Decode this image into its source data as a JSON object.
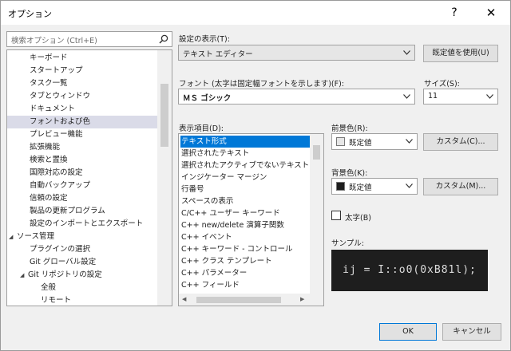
{
  "window": {
    "title": "オプション",
    "help_label": "?",
    "close_label": "✕"
  },
  "search": {
    "placeholder": "検索オプション (Ctrl+E)"
  },
  "tree": {
    "items": [
      {
        "label": "キーボード",
        "indent": 1
      },
      {
        "label": "スタートアップ",
        "indent": 1
      },
      {
        "label": "タスク一覧",
        "indent": 1
      },
      {
        "label": "タブとウィンドウ",
        "indent": 1
      },
      {
        "label": "ドキュメント",
        "indent": 1
      },
      {
        "label": "フォントおよび色",
        "indent": 1,
        "selected": true
      },
      {
        "label": "プレビュー機能",
        "indent": 1
      },
      {
        "label": "拡張機能",
        "indent": 1
      },
      {
        "label": "検索と置換",
        "indent": 1
      },
      {
        "label": "国際対応の設定",
        "indent": 1
      },
      {
        "label": "自動バックアップ",
        "indent": 1
      },
      {
        "label": "信頼の設定",
        "indent": 1
      },
      {
        "label": "製品の更新プログラム",
        "indent": 1
      },
      {
        "label": "設定のインポートとエクスポート",
        "indent": 1
      },
      {
        "label": "ソース管理",
        "indent": 0,
        "expanded": true
      },
      {
        "label": "プラグインの選択",
        "indent": 1
      },
      {
        "label": "Git グローバル設定",
        "indent": 1
      },
      {
        "label": "Git リポジトリの設定",
        "indent": 1,
        "expanded": true
      },
      {
        "label": "全般",
        "indent": 2
      },
      {
        "label": "リモート",
        "indent": 2
      }
    ]
  },
  "settings_display": {
    "label": "設定の表示(T):",
    "value": "テキスト エディター"
  },
  "use_defaults_label": "既定値を使用(U)",
  "font": {
    "label": "フォント (太字は固定幅フォントを示します)(F):",
    "value": "ＭＳ ゴシック"
  },
  "size": {
    "label": "サイズ(S):",
    "value": "11"
  },
  "display_items": {
    "label": "表示項目(D):",
    "items": [
      {
        "label": "テキスト形式",
        "selected": true
      },
      {
        "label": "選択されたテキスト"
      },
      {
        "label": "選択されたアクティブでないテキスト"
      },
      {
        "label": "インジケーター マージン"
      },
      {
        "label": "行番号"
      },
      {
        "label": "スペースの表示"
      },
      {
        "label": "C/C++ ユーザー キーワード"
      },
      {
        "label": "C++ new/delete 演算子関数"
      },
      {
        "label": "C++ イベント"
      },
      {
        "label": "C++ キーワード - コントロール"
      },
      {
        "label": "C++ クラス テンプレート"
      },
      {
        "label": "C++ パラメーター"
      },
      {
        "label": "C++ フィールド"
      }
    ]
  },
  "foreground": {
    "label": "前景色(R):",
    "value": "既定値",
    "swatch_color": "#e6e6e6",
    "custom_label": "カスタム(C)..."
  },
  "background": {
    "label": "背景色(K):",
    "value": "既定値",
    "swatch_color": "#1e1e1e",
    "custom_label": "カスタム(M)..."
  },
  "bold": {
    "label": "太字(B)",
    "checked": false
  },
  "sample": {
    "label": "サンプル:",
    "text": "ij = I::o0(0xB81l);",
    "background": "#1e1e1e",
    "foreground": "#dcdcdc"
  },
  "ok_label": "OK",
  "cancel_label": "キャンセル",
  "colors": {
    "accent": "#0078d7",
    "tree_selected": "#dadbe8"
  }
}
